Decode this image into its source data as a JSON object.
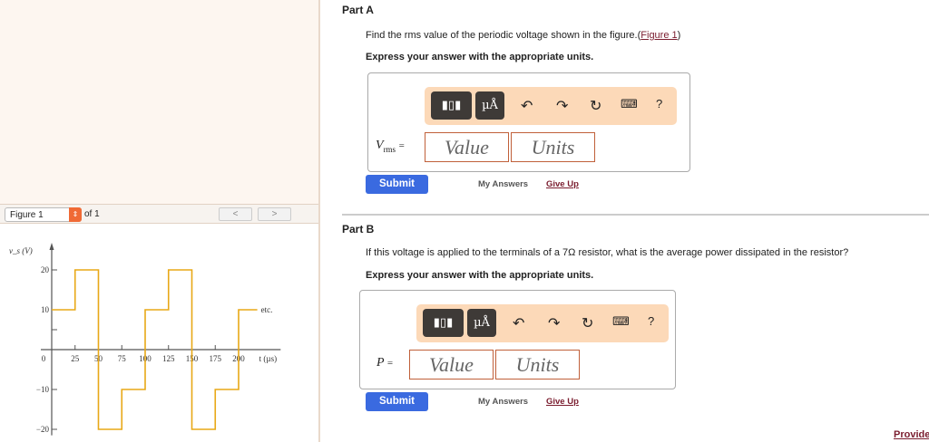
{
  "figure_panel": {
    "selector": "Figure 1",
    "of_label": "of 1",
    "prev": "<",
    "next": ">"
  },
  "chart_data": {
    "type": "line",
    "ylabel": "v_s (V)",
    "xlabel": "t (µs)",
    "xticks": [
      0,
      25,
      50,
      75,
      100,
      125,
      150,
      175,
      200
    ],
    "yticks": [
      20,
      10,
      -10,
      -20
    ],
    "xlim": [
      0,
      220
    ],
    "ylim": [
      -20,
      20
    ],
    "annotation": "etc.",
    "color": "#e8a817",
    "series": [
      {
        "name": "v_s",
        "points": [
          [
            0,
            10
          ],
          [
            25,
            10
          ],
          [
            25,
            20
          ],
          [
            50,
            20
          ],
          [
            50,
            -20
          ],
          [
            75,
            -20
          ],
          [
            75,
            -10
          ],
          [
            100,
            -10
          ],
          [
            100,
            10
          ],
          [
            125,
            10
          ],
          [
            125,
            20
          ],
          [
            150,
            20
          ],
          [
            150,
            -20
          ],
          [
            175,
            -20
          ],
          [
            175,
            -10
          ],
          [
            200,
            -10
          ],
          [
            200,
            10
          ],
          [
            220,
            10
          ]
        ]
      }
    ]
  },
  "partA": {
    "title": "Part A",
    "question": "Find the rms value of the periodic voltage shown in the figure.(",
    "link": "Figure 1",
    "question_end": ")",
    "instruction": "Express your answer with the appropriate units.",
    "var_main": "V",
    "var_sub": "rms",
    "eq": "=",
    "value_placeholder": "Value",
    "units_placeholder": "Units",
    "submit": "Submit",
    "my_answers": "My Answers",
    "give_up": "Give Up"
  },
  "partB": {
    "title": "Part B",
    "question": "If this voltage is applied to the terminals of a 7Ω resistor, what is the average power dissipated in the resistor?",
    "instruction": "Express your answer with the appropriate units.",
    "var_main": "P",
    "eq": "=",
    "value_placeholder": "Value",
    "units_placeholder": "Units",
    "submit": "Submit",
    "my_answers": "My Answers",
    "give_up": "Give Up"
  },
  "toolbar": {
    "units_btn": "µÅ",
    "help": "?"
  },
  "footer_link": "Provide"
}
